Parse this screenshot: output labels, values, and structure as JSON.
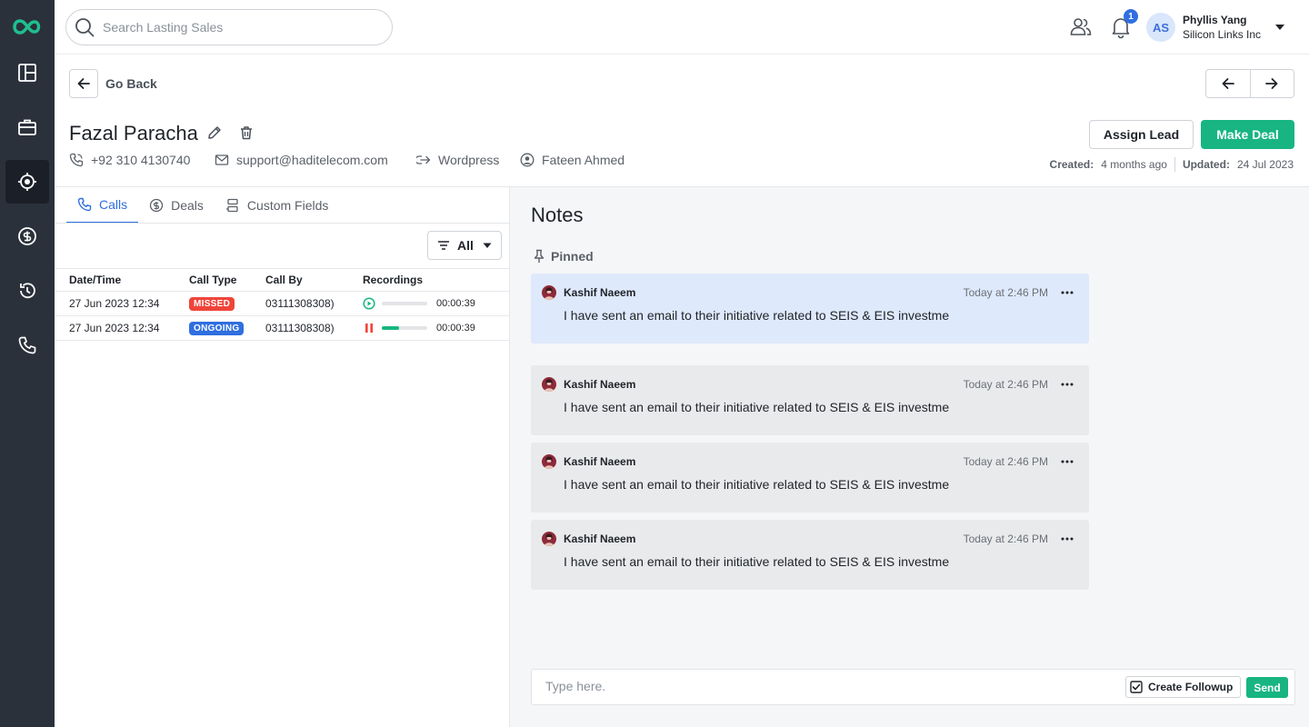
{
  "search": {
    "placeholder": "Search Lasting Sales"
  },
  "notifications": {
    "count": "1"
  },
  "user": {
    "initials": "AS",
    "name": "Phyllis Yang",
    "company": "Silicon Links Inc"
  },
  "header": {
    "back_label": "Go Back"
  },
  "lead": {
    "name": "Fazal Paracha",
    "phone": "+92 310 4130740",
    "email": "support@haditelecom.com",
    "source": "Wordpress",
    "owner": "Fateen Ahmed"
  },
  "actions": {
    "assign_label": "Assign Lead",
    "deal_label": "Make Deal"
  },
  "dates": {
    "created_label": "Created:",
    "created_value": "4 months ago",
    "updated_label": "Updated:",
    "updated_value": "24 Jul 2023"
  },
  "tabs": [
    {
      "label": "Calls",
      "icon": "phone-icon",
      "active": true
    },
    {
      "label": "Deals",
      "icon": "dollar-icon",
      "active": false
    },
    {
      "label": "Custom Fields",
      "icon": "fields-icon",
      "active": false
    }
  ],
  "filter": {
    "value": "All"
  },
  "calls_table": {
    "headers": [
      "Date/Time",
      "Call Type",
      "Call By",
      "Recordings"
    ],
    "rows": [
      {
        "datetime": "27 Jun 2023 12:34",
        "type": "MISSED",
        "type_color": "#f0443a",
        "call_by": "03111308308)",
        "state": "play",
        "progress": 0.0,
        "duration": "00:00:39"
      },
      {
        "datetime": "27 Jun 2023 12:34",
        "type": "ONGOING",
        "type_color": "#2f6fe0",
        "call_by": "03111308308)",
        "state": "pause",
        "progress": 0.38,
        "duration": "00:00:39"
      }
    ]
  },
  "notes": {
    "title": "Notes",
    "pinned_label": "Pinned",
    "items": [
      {
        "author": "Kashif Naeem",
        "time": "Today at 2:46 PM",
        "text": "I have sent an email to their initiative related to SEIS & EIS investme",
        "pinned": true
      },
      {
        "author": "Kashif Naeem",
        "time": "Today at 2:46 PM",
        "text": "I have sent an email to their initiative related to SEIS & EIS investme",
        "pinned": false
      },
      {
        "author": "Kashif Naeem",
        "time": "Today at 2:46 PM",
        "text": "I have sent an email to their initiative related to SEIS & EIS investme",
        "pinned": false
      },
      {
        "author": "Kashif Naeem",
        "time": "Today at 2:46 PM",
        "text": "I have sent an email to their initiative related to SEIS & EIS investme",
        "pinned": false
      }
    ]
  },
  "composer": {
    "placeholder": "Type here.",
    "followup_label": "Create Followup",
    "send_label": "Send"
  },
  "colors": {
    "primary": "#18b582",
    "accent": "#2f6fe0",
    "sidebar": "#2b313b",
    "missed": "#f0443a"
  }
}
